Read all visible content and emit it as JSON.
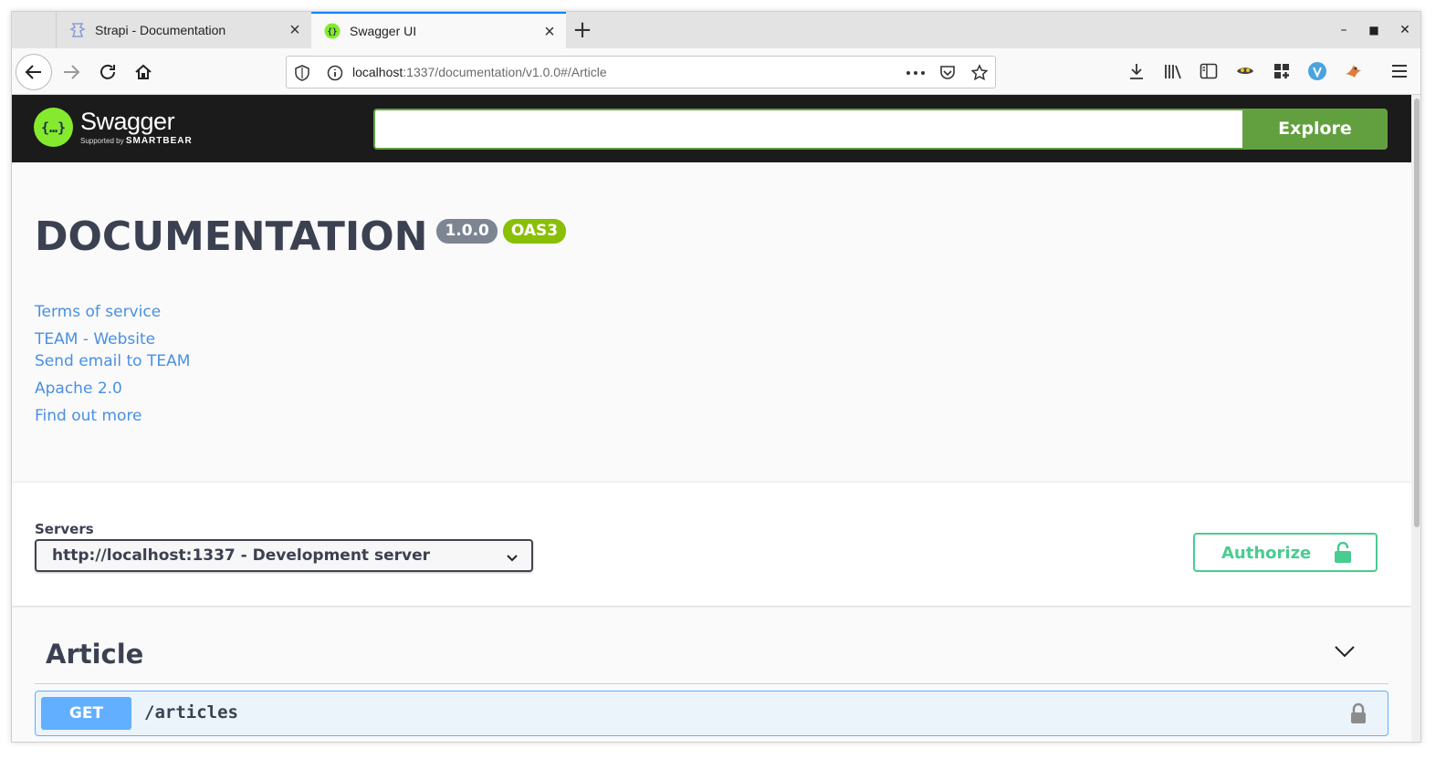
{
  "browser": {
    "tabs": [
      {
        "title": "Strapi - Documentation",
        "active": false
      },
      {
        "title": "Swagger UI",
        "active": true
      }
    ],
    "url_host": "localhost",
    "url_rest": ":1337/documentation/v1.0.0#/Article",
    "window_controls": {
      "minimize": "–",
      "maximize": "□",
      "close": "✕"
    }
  },
  "swagger": {
    "brand": "Swagger",
    "brand_sub": "Supported by",
    "brand_sub_strong": "SMARTBEAR",
    "search_value": "",
    "explore_label": "Explore",
    "accent_color": "#62a03f"
  },
  "info": {
    "title": "DOCUMENTATION",
    "version": "1.0.0",
    "oas": "OAS3",
    "links": {
      "terms": "Terms of service",
      "website": "TEAM - Website",
      "email": "Send email to TEAM",
      "license": "Apache 2.0",
      "more": "Find out more"
    }
  },
  "servers": {
    "label": "Servers",
    "selected": "http://localhost:1337 - Development server",
    "authorize_label": "Authorize"
  },
  "tags": [
    {
      "name": "Article",
      "operations": [
        {
          "method": "GET",
          "path": "/articles",
          "color": "#61affe"
        }
      ]
    }
  ]
}
